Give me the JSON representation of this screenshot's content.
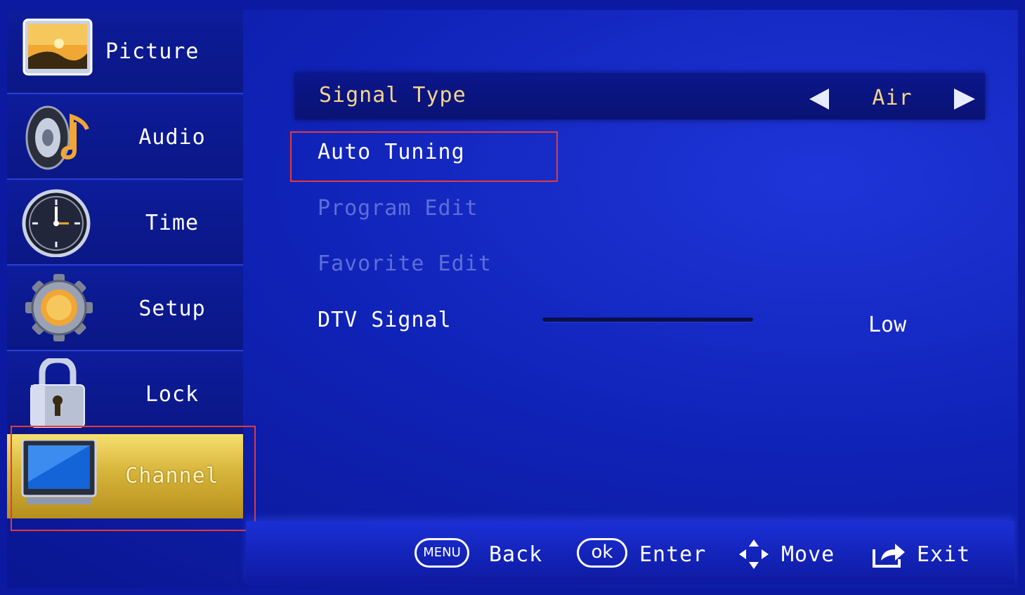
{
  "sidebar": {
    "items": [
      {
        "label": "Picture",
        "icon": "picture-icon"
      },
      {
        "label": "Audio",
        "icon": "speaker-icon"
      },
      {
        "label": "Time",
        "icon": "clock-icon"
      },
      {
        "label": "Setup",
        "icon": "gear-icon"
      },
      {
        "label": "Lock",
        "icon": "padlock-icon"
      },
      {
        "label": "Channel",
        "icon": "tv-icon",
        "selected": true
      }
    ]
  },
  "channel_menu": {
    "signal_type": {
      "label": "Signal Type",
      "value": "Air"
    },
    "auto_tuning": {
      "label": "Auto Tuning"
    },
    "program_edit": {
      "label": "Program Edit",
      "enabled": false
    },
    "favorite_edit": {
      "label": "Favorite Edit",
      "enabled": false
    },
    "dtv_signal": {
      "label": "DTV Signal",
      "level": "Low",
      "strength_percent": 0
    }
  },
  "help_bar": {
    "menu_key": "MENU",
    "back": "Back",
    "ok_key": "ok",
    "enter": "Enter",
    "move": "Move",
    "exit": "Exit"
  },
  "colors": {
    "background": "#1023b8",
    "selected_item": "#d6b43a",
    "value_text": "#f4d58a",
    "disabled_text": "#5d6fd6",
    "highlight_box": "#e23a3a"
  }
}
